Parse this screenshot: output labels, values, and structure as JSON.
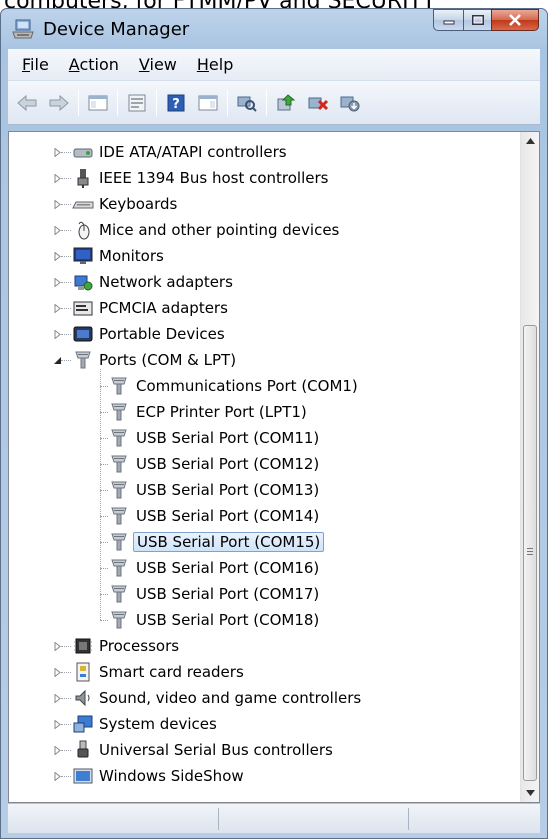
{
  "page": {
    "cut_text": "computers, for FTMM/PV and SECURITY"
  },
  "window": {
    "title": "Device Manager"
  },
  "menu": [
    {
      "label_prefix": "",
      "accel": "F",
      "label_rest": "ile"
    },
    {
      "label_prefix": "",
      "accel": "A",
      "label_rest": "ction"
    },
    {
      "label_prefix": "",
      "accel": "V",
      "label_rest": "iew"
    },
    {
      "label_prefix": "",
      "accel": "H",
      "label_rest": "elp"
    }
  ],
  "toolbar": {
    "icons": [
      "back-icon",
      "forward-icon",
      "show-hide-tree-icon",
      "properties-icon",
      "help-icon",
      "action-pane-icon",
      "scan-hardware-icon",
      "update-driver-icon",
      "uninstall-icon",
      "disable-icon"
    ]
  },
  "tree": {
    "categories_before": [
      {
        "label": "IDE ATA/ATAPI controllers",
        "icon": "ide-controller-icon"
      },
      {
        "label": "IEEE 1394 Bus host controllers",
        "icon": "ieee1394-icon"
      },
      {
        "label": "Keyboards",
        "icon": "keyboard-icon"
      },
      {
        "label": "Mice and other pointing devices",
        "icon": "mouse-icon"
      },
      {
        "label": "Monitors",
        "icon": "monitor-icon"
      },
      {
        "label": "Network adapters",
        "icon": "network-adapter-icon"
      },
      {
        "label": "PCMCIA adapters",
        "icon": "pcmcia-icon"
      },
      {
        "label": "Portable Devices",
        "icon": "portable-device-icon"
      }
    ],
    "expanded": {
      "label": "Ports (COM & LPT)",
      "icon": "port-icon",
      "children": [
        "Communications Port (COM1)",
        "ECP Printer Port (LPT1)",
        "USB Serial Port (COM11)",
        "USB Serial Port (COM12)",
        "USB Serial Port (COM13)",
        "USB Serial Port (COM14)",
        "USB Serial Port (COM15)",
        "USB Serial Port (COM16)",
        "USB Serial Port (COM17)",
        "USB Serial Port (COM18)"
      ],
      "selected": "USB Serial Port (COM15)"
    },
    "categories_after": [
      {
        "label": "Processors",
        "icon": "processor-icon"
      },
      {
        "label": "Smart card readers",
        "icon": "smart-card-icon"
      },
      {
        "label": "Sound, video and game controllers",
        "icon": "sound-icon"
      },
      {
        "label": "System devices",
        "icon": "system-device-icon"
      },
      {
        "label": "Universal Serial Bus controllers",
        "icon": "usb-icon"
      },
      {
        "label": "Windows SideShow",
        "icon": "sideshow-icon"
      }
    ]
  },
  "colors": {
    "selection_border": "#7da2ce",
    "close_button": "#c1381a",
    "window_frame": "#a9c4e2"
  }
}
